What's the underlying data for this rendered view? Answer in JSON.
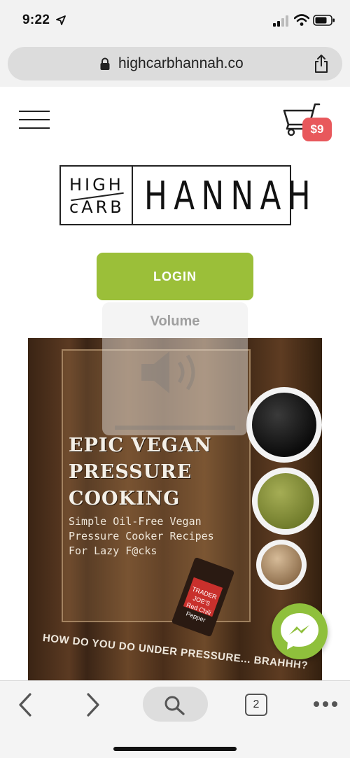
{
  "status_bar": {
    "time": "9:22",
    "icons": [
      "location-arrow-icon",
      "cellular-signal-icon",
      "wifi-icon",
      "battery-icon"
    ]
  },
  "browser": {
    "url": "highcarbhannah.co",
    "icons": [
      "lock-icon",
      "share-icon"
    ]
  },
  "header": {
    "menu_icon": "hamburger-menu-icon",
    "cart_icon": "shopping-cart-icon",
    "cart_total": "$9"
  },
  "logo": {
    "line1": "HIGH",
    "line2": "cARB",
    "name": "HANNAH"
  },
  "login_button": "LOGIN",
  "volume_overlay": {
    "label": "Volume",
    "icon": "speaker-icon"
  },
  "hero": {
    "title_lines": [
      "EPIC VEGAN",
      "PRESSURE",
      "COOKING"
    ],
    "subtitle_lines": [
      "Simple Oil-Free Vegan",
      "Pressure Cooker Recipes",
      "For Lazy F@cks"
    ],
    "tagline": "HOW DO YOU DO UNDER PRESSURE... BRAHHH?",
    "jar_label": "Red Chili Pepper",
    "jar_brand": "TRADER JOE'S"
  },
  "messenger_icon": "messenger-chat-icon",
  "toolbar": {
    "tab_count": "2",
    "icons": [
      "back-arrow-icon",
      "forward-arrow-icon",
      "search-icon",
      "tabs-icon",
      "more-icon"
    ]
  },
  "colors": {
    "brand_green": "#9bbf39",
    "cart_badge": "#e8585c",
    "messenger": "#8fc03c"
  }
}
